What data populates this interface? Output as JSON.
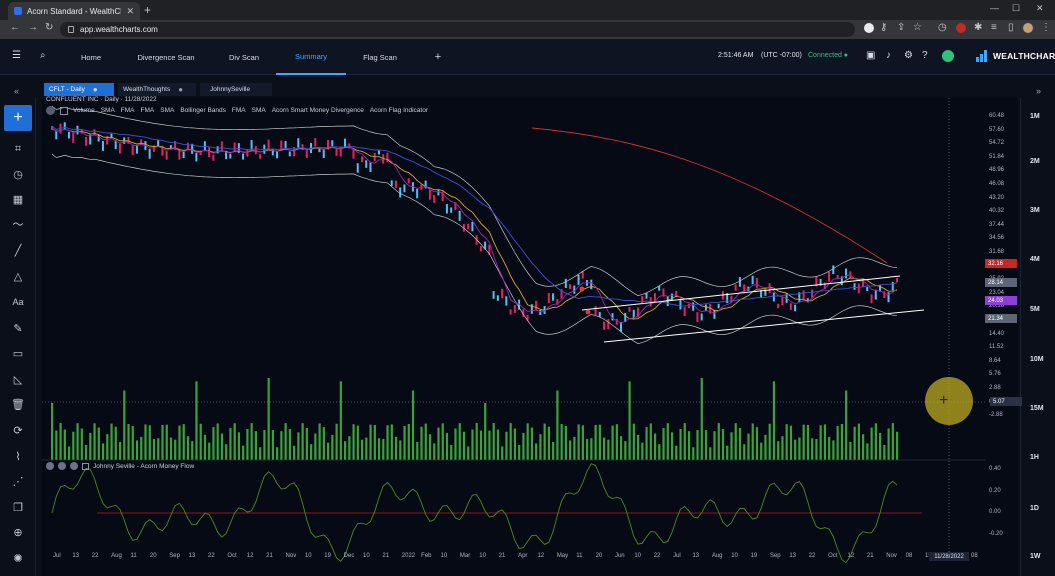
{
  "browser": {
    "tab_title": "Acorn Standard - WealthCharts",
    "url": "app.wealthcharts.com"
  },
  "nav": {
    "items": [
      "Home",
      "Divergence Scan",
      "Div Scan",
      "Summary",
      "Flag Scan"
    ],
    "active": "Summary",
    "add": "+"
  },
  "status": {
    "time": "2:51:46 AM",
    "timezone": "(UTC -07:00)",
    "connection": "Connected"
  },
  "logo": {
    "text": "WEALTHCHARTS"
  },
  "chart_tabs": [
    {
      "label": "CFLT - Daily",
      "active": true
    },
    {
      "label": "WealthThoughts",
      "active": false
    },
    {
      "label": "JohnnySeville",
      "active": false
    }
  ],
  "chart": {
    "ticker_line": "CONFLUENT INC · Daily · 11/28/2022",
    "indicators": [
      "Volume",
      "SMA",
      "FMA",
      "FMA",
      "SMA",
      "Bollinger Bands",
      "FMA",
      "SMA",
      "Acorn Smart Money Divergence",
      "Acorn Flag Indicator"
    ],
    "lower_indicator": "Johnny Seville - Acorn Money Flow",
    "y_axis_labels": [
      "60.48",
      "57.60",
      "54.72",
      "51.84",
      "48.96",
      "46.08",
      "43.20",
      "40.32",
      "37.44",
      "34.56",
      "31.68",
      "28.80",
      "25.92",
      "23.04",
      "20.16",
      "17.28",
      "14.40",
      "11.52",
      "8.64",
      "5.76",
      "2.88",
      "0.00",
      "-2.88"
    ],
    "lower_axis_labels": [
      "0.40",
      "0.20",
      "0.00",
      "-0.20"
    ],
    "price_tags": [
      {
        "value": "32.16",
        "color": "#c62828"
      },
      {
        "value": "28.14",
        "color": "#5d6577"
      },
      {
        "value": "24.03",
        "color": "#8e3fd6"
      },
      {
        "value": "21.34",
        "color": "#5d6577"
      },
      {
        "value": "5.07",
        "color": "#2a3246"
      }
    ],
    "x_axis_labels": [
      "Jul",
      "13",
      "22",
      "Aug",
      "11",
      "20",
      "Sep",
      "13",
      "22",
      "Oct",
      "12",
      "21",
      "Nov",
      "10",
      "19",
      "Dec",
      "10",
      "21",
      "2022",
      "Feb",
      "10",
      "Mar",
      "10",
      "21",
      "Apr",
      "12",
      "May",
      "11",
      "20",
      "Jun",
      "10",
      "22",
      "Jul",
      "13",
      "Aug",
      "10",
      "19",
      "Sep",
      "13",
      "22",
      "Oct",
      "12",
      "21",
      "Nov",
      "08",
      "15"
    ],
    "date_box": "11/28/2022",
    "date_after": "08"
  },
  "timeframes": [
    "1M",
    "2M",
    "3M",
    "4M",
    "5M",
    "10M",
    "15M",
    "1H",
    "1D",
    "1W"
  ],
  "colors": {
    "accent": "#1f6fd6",
    "link": "#3ea6ff",
    "connected": "#2ec27e",
    "sma_red": "#d32f2f",
    "sma_blue": "#3f51d4",
    "ema_yellow": "#d4a82a",
    "ema_purple": "#9c27b0",
    "volume": "#3aa33a"
  }
}
